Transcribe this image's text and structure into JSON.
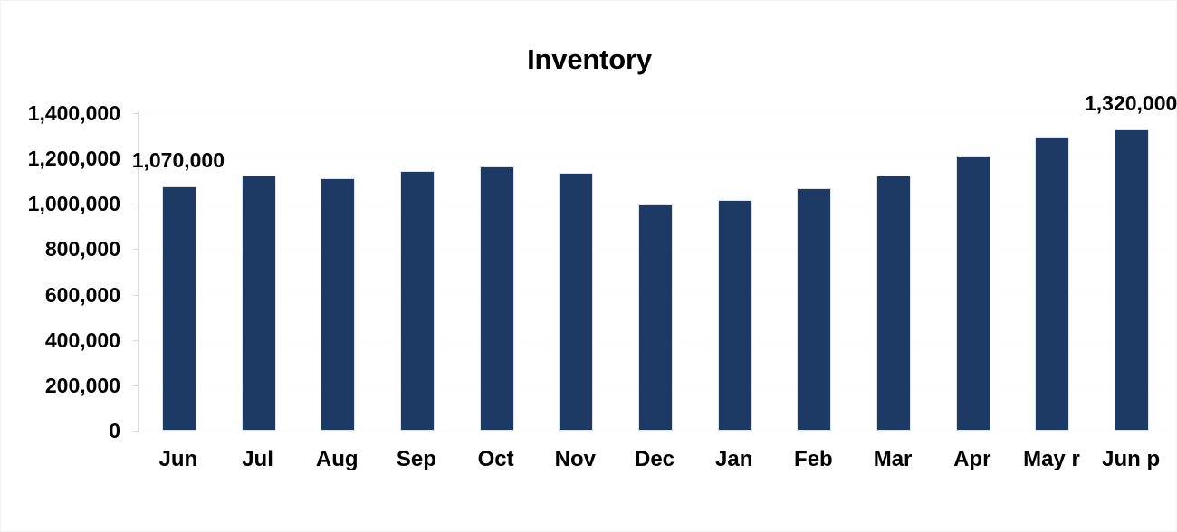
{
  "chart_data": {
    "type": "bar",
    "title": "Inventory",
    "xlabel": "",
    "ylabel": "",
    "categories": [
      "Jun",
      "Jul",
      "Aug",
      "Sep",
      "Oct",
      "Nov",
      "Dec",
      "Jan",
      "Feb",
      "Mar",
      "Apr",
      "May r",
      "Jun p"
    ],
    "values": [
      1070000,
      1115000,
      1105000,
      1135000,
      1155000,
      1130000,
      990000,
      1010000,
      1060000,
      1115000,
      1205000,
      1290000,
      1320000
    ],
    "ylim": [
      0,
      1400000
    ],
    "ytick_values": [
      0,
      200000,
      400000,
      600000,
      800000,
      1000000,
      1200000,
      1400000
    ],
    "ytick_labels": [
      "0",
      "200,000",
      "400,000",
      "600,000",
      "800,000",
      "1,000,000",
      "1,200,000",
      "1,400,000"
    ],
    "grid": false,
    "legend": false,
    "legend_position": "none",
    "series": [
      {
        "name": "Inventory",
        "color": "#1C3A63",
        "values": [
          1070000,
          1115000,
          1105000,
          1135000,
          1155000,
          1130000,
          990000,
          1010000,
          1060000,
          1115000,
          1205000,
          1290000,
          1320000
        ]
      }
    ],
    "data_labels": [
      {
        "category": "Jun",
        "text": "1,070,000"
      },
      {
        "category": "Jun p",
        "text": "1,320,000"
      }
    ],
    "colors": {
      "bar_fill": "#1C3A63",
      "bar_border": "#DFE3E8",
      "axis": "#D9D9D9",
      "text": "#000000",
      "background": "#FFFFFF"
    }
  }
}
